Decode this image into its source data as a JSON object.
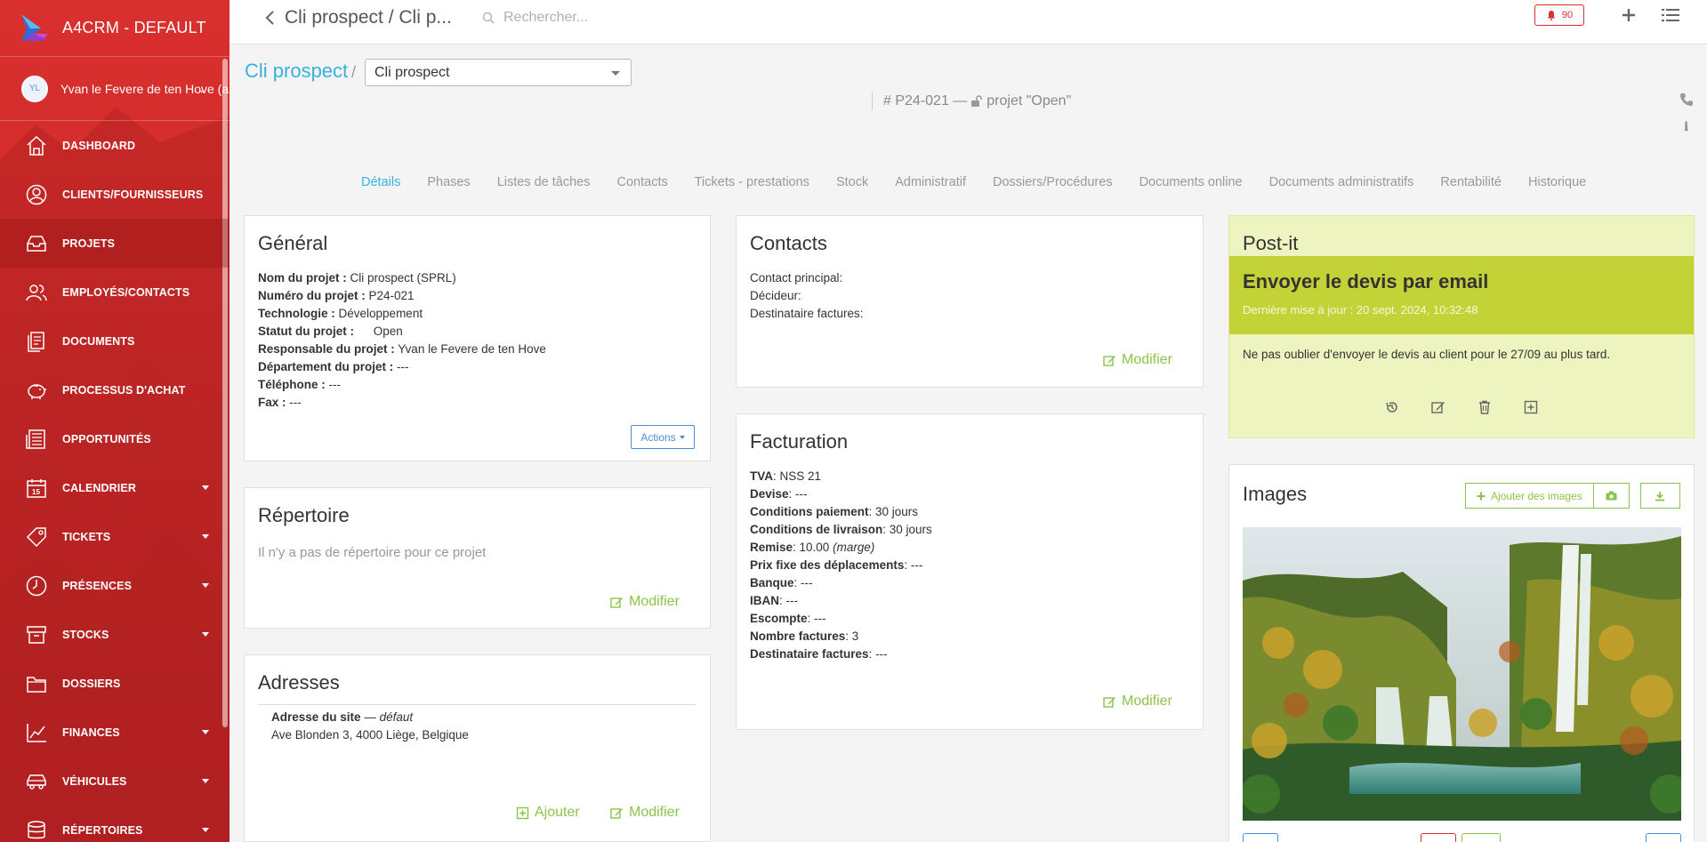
{
  "app": {
    "title": "A4CRM - DEFAULT"
  },
  "user": {
    "name": "Yvan le Fevere de ten Hove (a",
    "initials": "YL"
  },
  "sidebar": {
    "items": [
      {
        "label": "DASHBOARD",
        "icon": "home-icon",
        "caret": false,
        "active": false
      },
      {
        "label": "CLIENTS/FOURNISSEURS",
        "icon": "user-circle-icon",
        "caret": false,
        "active": false
      },
      {
        "label": "PROJETS",
        "icon": "inbox-icon",
        "caret": false,
        "active": true
      },
      {
        "label": "EMPLOYÉS/CONTACTS",
        "icon": "users-icon",
        "caret": false,
        "active": false
      },
      {
        "label": "DOCUMENTS",
        "icon": "documents-icon",
        "caret": false,
        "active": false
      },
      {
        "label": "PROCESSUS D'ACHAT",
        "icon": "piggy-bank-icon",
        "caret": false,
        "active": false
      },
      {
        "label": "OPPORTUNITÉS",
        "icon": "newspaper-icon",
        "caret": false,
        "active": false
      },
      {
        "label": "CALENDRIER",
        "icon": "calendar-icon",
        "caret": true,
        "active": false
      },
      {
        "label": "TICKETS",
        "icon": "tag-icon",
        "caret": true,
        "active": false
      },
      {
        "label": "PRÉSENCES",
        "icon": "clock-icon",
        "caret": true,
        "active": false
      },
      {
        "label": "STOCKS",
        "icon": "archive-icon",
        "caret": true,
        "active": false
      },
      {
        "label": "DOSSIERS",
        "icon": "folder-icon",
        "caret": false,
        "active": false
      },
      {
        "label": "FINANCES",
        "icon": "chart-line-icon",
        "caret": true,
        "active": false
      },
      {
        "label": "VÉHICULES",
        "icon": "car-icon",
        "caret": true,
        "active": false
      },
      {
        "label": "RÉPERTOIRES",
        "icon": "database-icon",
        "caret": true,
        "active": false
      }
    ]
  },
  "topbar": {
    "title": "Cli prospect / Cli p...",
    "search_placeholder": "Rechercher...",
    "notifications": "90"
  },
  "breadcrumb": {
    "root": "Cli prospect",
    "sep": "/",
    "selected": "Cli prospect"
  },
  "project": {
    "ref": "# P24-021 —",
    "status": "projet \"Open\""
  },
  "tabs": [
    "Détails",
    "Phases",
    "Listes de tâches",
    "Contacts",
    "Tickets - prestations",
    "Stock",
    "Administratif",
    "Dossiers/Procédures",
    "Documents online",
    "Documents administratifs",
    "Rentabilité",
    "Historique"
  ],
  "general": {
    "title": "Général",
    "rows": [
      {
        "label": "Nom du projet :",
        "value": "Cli prospect (SPRL)"
      },
      {
        "label": "Numéro du projet :",
        "value": "P24-021"
      },
      {
        "label": "Technologie :",
        "value": "Développement"
      },
      {
        "label": "Statut du projet :",
        "value": "Open"
      },
      {
        "label": "Responsable du projet :",
        "value": "Yvan le Fevere de ten Hove"
      },
      {
        "label": "Département du projet :",
        "value": "---"
      },
      {
        "label": "Téléphone :",
        "value": "---"
      },
      {
        "label": "Fax :",
        "value": "---"
      }
    ],
    "actions_label": "Actions"
  },
  "repertoire": {
    "title": "Répertoire",
    "empty": "Il n'y a pas de répertoire pour ce projet",
    "modify": "Modifier"
  },
  "adresses": {
    "title": "Adresses",
    "label": "Adresse du site",
    "dash": "—",
    "default": "défaut",
    "address": "Ave Blonden 3, 4000 Liège, Belgique",
    "add": "Ajouter",
    "modify": "Modifier"
  },
  "contacts": {
    "title": "Contacts",
    "rows": [
      "Contact principal:",
      "Décideur:",
      "Destinataire factures:"
    ],
    "modify": "Modifier"
  },
  "facturation": {
    "title": "Facturation",
    "rows": [
      {
        "label": "TVA",
        "value": ": NSS 21"
      },
      {
        "label": "Devise",
        "value": ": ---"
      },
      {
        "label": "Conditions paiement",
        "value": ": 30 jours"
      },
      {
        "label": "Conditions de livraison",
        "value": ": 30 jours"
      },
      {
        "label": "Remise",
        "value": ": 10.00",
        "extra": "(marge)"
      },
      {
        "label": "Prix fixe des déplacements",
        "value": ": ---"
      },
      {
        "label": "Banque",
        "value": ": ---"
      },
      {
        "label": "IBAN",
        "value": ": ---"
      },
      {
        "label": "Escompte",
        "value": ": ---"
      },
      {
        "label": "Nombre factures",
        "value": ": 3"
      },
      {
        "label": "Destinataire factures",
        "value": ": ---"
      }
    ],
    "modify": "Modifier"
  },
  "postit": {
    "title": "Post-it",
    "note_title": "Envoyer le devis par email",
    "updated": "Dernière mise à jour : 20 sept. 2024, 10:32:48",
    "text": "Ne pas oublier d'envoyer le devis au client pour le 27/09 au plus tard."
  },
  "images": {
    "title": "Images",
    "add_label": "Ajouter des images"
  },
  "colors": {
    "brand": "#d9302e",
    "link": "#37b2dc",
    "accent": "#8cc34a",
    "postit": "#c3d237"
  }
}
